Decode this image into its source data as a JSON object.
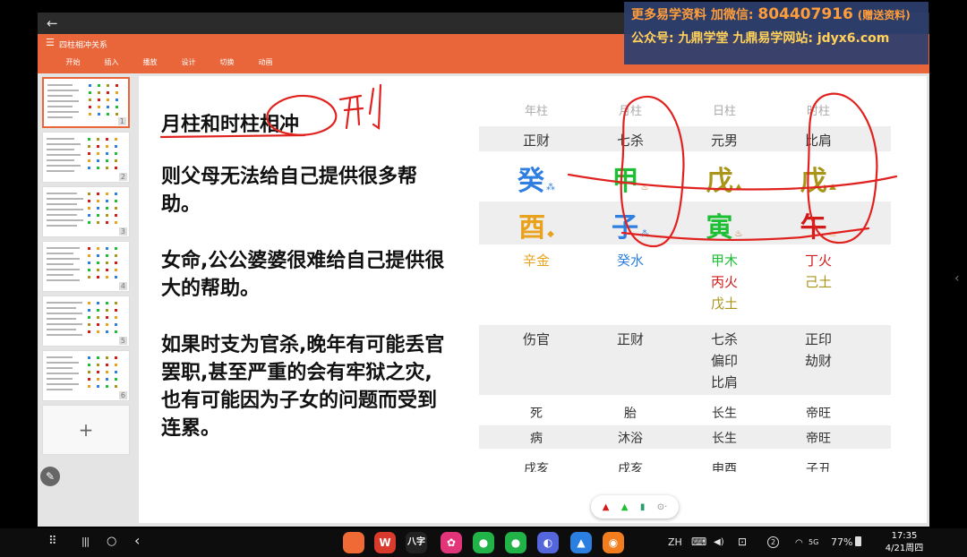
{
  "window": {
    "back_icon": "arrow-left-icon",
    "back_glyph": "←"
  },
  "watermark": {
    "line1_prefix": "更多易学资料 加微信:",
    "line1_number": "804407916",
    "line1_suffix": "(赠送资料)",
    "line2": "公众号: 九鼎学堂 九鼎易学网站: jdyx6.com"
  },
  "ribbon": {
    "menu_glyph": "☰",
    "doc_title": "四柱相冲关系",
    "tabs": [
      "开始",
      "插入",
      "播放",
      "设计",
      "切换",
      "动画"
    ]
  },
  "thumbnails": {
    "numbers": [
      "1",
      "2",
      "3",
      "4",
      "5",
      "6"
    ],
    "selected": 0,
    "add_glyph": "+"
  },
  "slide": {
    "title_part1": "月柱和时柱",
    "title_part2": "相冲",
    "handwritten_note": "刑",
    "para1": "则父母无法给自己提供很多帮助。",
    "para2": "女命,公公婆婆很难给自己提供很大的帮助。",
    "para3": "如果时支为官杀,晚年有可能丢官罢职,甚至严重的会有牢狱之灾,也有可能因为子女的问题而受到连累。"
  },
  "bazi": {
    "headers": [
      "年柱",
      "月柱",
      "日柱",
      "时柱"
    ],
    "gods": [
      "正财",
      "七杀",
      "元男",
      "比肩"
    ],
    "stems": [
      {
        "char": "癸",
        "color": "#2f7fe0",
        "mark": "water-icon",
        "glyph": "⁂"
      },
      {
        "char": "甲",
        "color": "#1fbf35",
        "mark": "fire-icon",
        "glyph": "♨"
      },
      {
        "char": "戊",
        "color": "#a8951a",
        "mark": "earth-icon",
        "glyph": "⛰"
      },
      {
        "char": "戊",
        "color": "#a8951a",
        "mark": "earth-icon",
        "glyph": "⛰"
      }
    ],
    "branches": [
      {
        "char": "酉",
        "color": "#e8a21c",
        "mark": "metal-icon",
        "glyph": "◆"
      },
      {
        "char": "子",
        "color": "#2f7fe0",
        "mark": "water-icon",
        "glyph": "⁂"
      },
      {
        "char": "寅",
        "color": "#1fbf35",
        "mark": "fire-icon",
        "glyph": "♨"
      },
      {
        "char": "午",
        "color": "#d11a1a",
        "mark": "fire-icon",
        "glyph": "♨"
      }
    ],
    "hidden_stems": [
      [
        {
          "text": "辛金",
          "color": "#e8a21c"
        }
      ],
      [
        {
          "text": "癸水",
          "color": "#2f7fe0"
        }
      ],
      [
        {
          "text": "甲木",
          "color": "#1fbf35"
        },
        {
          "text": "丙火",
          "color": "#d11a1a"
        },
        {
          "text": "戊土",
          "color": "#a8951a"
        }
      ],
      [
        {
          "text": "丁火",
          "color": "#d11a1a"
        },
        {
          "text": "己土",
          "color": "#a8951a"
        }
      ]
    ],
    "hidden_gods": [
      [
        "伤官"
      ],
      [
        "正财"
      ],
      [
        "七杀",
        "偏印",
        "比肩"
      ],
      [
        "正印",
        "劫财"
      ]
    ],
    "life_stage1": [
      "死",
      "胎",
      "长生",
      "帝旺"
    ],
    "life_stage2": [
      "病",
      "沐浴",
      "长生",
      "帝旺"
    ],
    "kongwang": [
      "戌亥",
      "戌亥",
      "申酉",
      "子丑"
    ]
  },
  "annotation_color": "#e0221f",
  "draw_toolbar": {
    "tools": [
      "marker-icon",
      "highlighter-icon",
      "eraser-icon",
      "more-icon"
    ],
    "glyphs": [
      "▲",
      "▲",
      "▮",
      "⊙·"
    ]
  },
  "side_arrow": "‹",
  "taskbar": {
    "nav_glyphs": [
      "⠿",
      "|||",
      "○",
      "‹"
    ],
    "apps": [
      {
        "name": "app-icon-orange",
        "label": "",
        "color": "#f06a35"
      },
      {
        "name": "app-icon-wps",
        "label": "W",
        "color": "#d93a2b"
      },
      {
        "name": "app-icon-bazi",
        "label": "八字",
        "color": "#222222"
      },
      {
        "name": "app-icon-flower",
        "label": "✿",
        "color": "#e3347a"
      },
      {
        "name": "app-icon-wechat",
        "label": "●",
        "color": "#22b348"
      },
      {
        "name": "app-icon-wechat-2",
        "label": "●",
        "color": "#22b348"
      },
      {
        "name": "app-icon-planet",
        "label": "◐",
        "color": "#5566dd"
      },
      {
        "name": "app-icon-mountain",
        "label": "▲",
        "color": "#2a7fe0"
      },
      {
        "name": "app-icon-weibo",
        "label": "◉",
        "color": "#f27d1f"
      }
    ],
    "lang": "ZH",
    "status_glyphs": [
      "⌨",
      "◀)",
      "⊡"
    ],
    "notif_count": "2",
    "signal": "5G",
    "battery": "77%",
    "time": "17:35",
    "date": "4/21周四"
  }
}
